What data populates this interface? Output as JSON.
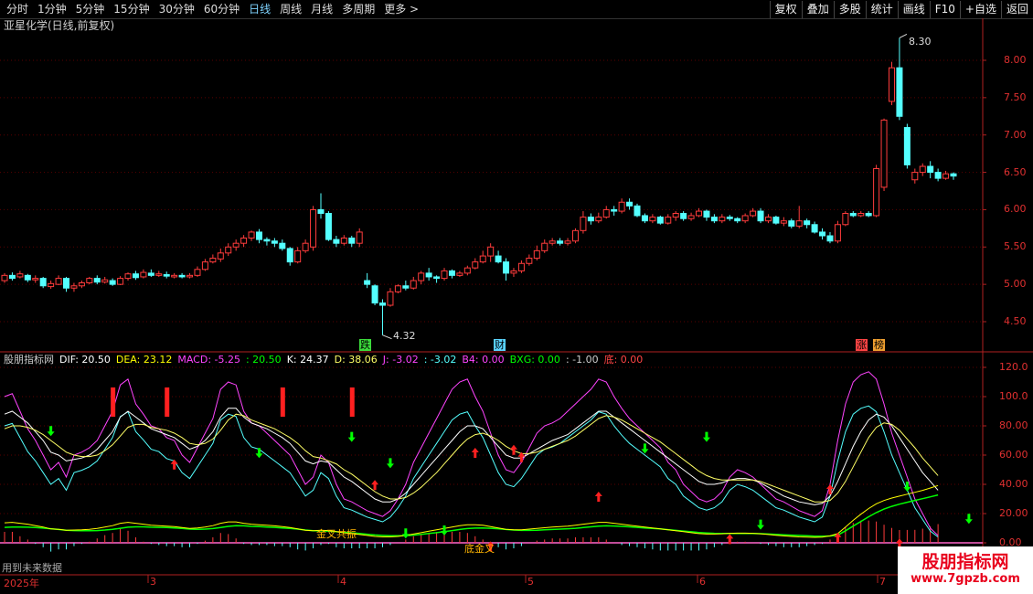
{
  "toolbar": {
    "periods": [
      "分时",
      "1分钟",
      "5分钟",
      "15分钟",
      "30分钟",
      "60分钟",
      "日线",
      "周线",
      "月线",
      "多周期",
      "更多 >"
    ],
    "actions": [
      "复权",
      "叠加",
      "多股",
      "统计",
      "画线",
      "F10",
      "+自选",
      "返回"
    ]
  },
  "stock": {
    "title": "亚星化学(日线,前复权)",
    "high_label": "8.30",
    "low_label": "4.32",
    "marker_die": "跌",
    "marker_cai": "财",
    "marker_zhang": "涨",
    "marker_bang": "榜",
    "y_ticks": [
      "8.00",
      "7.50",
      "7.00",
      "6.50",
      "6.00",
      "5.50",
      "5.00",
      "4.50"
    ]
  },
  "indicator": {
    "name": "股朋指标网",
    "dif": "DIF: 20.50",
    "dea": "DEA: 23.12",
    "macd": "MACD: -5.25",
    "v1": ": 20.50",
    "k": "K: 24.37",
    "d": "D: 38.06",
    "j": "J: -3.02",
    "v2": ": -3.02",
    "b4": "B4: 0.00",
    "bxg": "BXG: 0.00",
    "v3": ": -1.00",
    "di": "底: 0.00",
    "y_ticks": [
      "120.0",
      "100.0",
      "80.00",
      "60.00",
      "40.00",
      "20.00",
      "0.00"
    ],
    "annot_1": "金叉共振",
    "annot_2": "底金叉",
    "note": "用到未来数据"
  },
  "xaxis": {
    "labels": [
      "2025年",
      "3",
      "4",
      "5",
      "6",
      "7"
    ]
  },
  "watermark": {
    "line1": "股朋指标网",
    "line2": "www.7gpzb.com"
  },
  "colors": {
    "up": "#ff3c3c",
    "down": "#54ffff",
    "dif": "#ffffff",
    "dea": "#ffff00",
    "j": "#ff44ff",
    "k": "#ffffff",
    "d": "#ffff66",
    "bxg": "#00ff00"
  },
  "chart_data": {
    "type": "candlestick",
    "title": "亚星化学(日线,前复权)",
    "ylim": [
      4.2,
      8.5
    ],
    "candles": [
      [
        5.05,
        5.12,
        5.15,
        5.02
      ],
      [
        5.12,
        5.08,
        5.16,
        5.05
      ],
      [
        5.1,
        5.14,
        5.18,
        5.08
      ],
      [
        5.12,
        5.06,
        5.14,
        5.03
      ],
      [
        5.06,
        5.08,
        5.12,
        5.02
      ],
      [
        5.08,
        4.98,
        5.1,
        4.95
      ],
      [
        4.97,
        5.01,
        5.05,
        4.94
      ],
      [
        5.0,
        5.08,
        5.12,
        4.99
      ],
      [
        5.08,
        4.95,
        5.1,
        4.9
      ],
      [
        4.95,
        4.98,
        5.02,
        4.9
      ],
      [
        4.98,
        5.02,
        5.05,
        4.95
      ],
      [
        5.02,
        5.08,
        5.1,
        5.0
      ],
      [
        5.08,
        5.03,
        5.12,
        5.0
      ],
      [
        5.03,
        5.06,
        5.1,
        5.01
      ],
      [
        5.05,
        5.0,
        5.08,
        4.98
      ],
      [
        5.0,
        5.08,
        5.11,
        4.99
      ],
      [
        5.08,
        5.14,
        5.16,
        5.05
      ],
      [
        5.14,
        5.09,
        5.18,
        5.06
      ],
      [
        5.1,
        5.16,
        5.2,
        5.08
      ],
      [
        5.15,
        5.12,
        5.2,
        5.1
      ],
      [
        5.12,
        5.14,
        5.18,
        5.1
      ],
      [
        5.13,
        5.11,
        5.17,
        5.08
      ],
      [
        5.1,
        5.12,
        5.15,
        5.08
      ],
      [
        5.12,
        5.1,
        5.15,
        5.08
      ],
      [
        5.1,
        5.12,
        5.15,
        5.08
      ],
      [
        5.12,
        5.2,
        5.24,
        5.1
      ],
      [
        5.2,
        5.3,
        5.34,
        5.18
      ],
      [
        5.3,
        5.35,
        5.4,
        5.28
      ],
      [
        5.34,
        5.42,
        5.48,
        5.3
      ],
      [
        5.42,
        5.5,
        5.55,
        5.38
      ],
      [
        5.5,
        5.55,
        5.6,
        5.45
      ],
      [
        5.55,
        5.62,
        5.66,
        5.5
      ],
      [
        5.62,
        5.7,
        5.72,
        5.58
      ],
      [
        5.7,
        5.6,
        5.74,
        5.55
      ],
      [
        5.6,
        5.58,
        5.63,
        5.52
      ],
      [
        5.58,
        5.55,
        5.62,
        5.5
      ],
      [
        5.55,
        5.48,
        5.6,
        5.45
      ],
      [
        5.48,
        5.3,
        5.5,
        5.25
      ],
      [
        5.3,
        5.45,
        5.5,
        5.28
      ],
      [
        5.45,
        5.55,
        5.6,
        5.42
      ],
      [
        5.5,
        6.0,
        6.05,
        5.45
      ],
      [
        6.0,
        5.95,
        6.22,
        5.88
      ],
      [
        5.95,
        5.6,
        5.98,
        5.58
      ],
      [
        5.6,
        5.55,
        5.65,
        5.5
      ],
      [
        5.55,
        5.62,
        5.66,
        5.52
      ],
      [
        5.62,
        5.55,
        5.65,
        5.5
      ],
      [
        5.55,
        5.7,
        5.75,
        5.5
      ],
      [
        5.05,
        5.0,
        5.15,
        4.95
      ],
      [
        4.98,
        4.75,
        5.0,
        4.72
      ],
      [
        4.75,
        4.72,
        4.8,
        4.32
      ],
      [
        4.72,
        4.9,
        4.95,
        4.7
      ],
      [
        4.9,
        4.98,
        5.0,
        4.88
      ],
      [
        4.98,
        4.95,
        5.05,
        4.92
      ],
      [
        4.95,
        5.05,
        5.1,
        4.93
      ],
      [
        5.05,
        5.15,
        5.18,
        5.0
      ],
      [
        5.15,
        5.1,
        5.22,
        5.05
      ],
      [
        5.1,
        5.08,
        5.12,
        5.02
      ],
      [
        5.08,
        5.18,
        5.22,
        5.05
      ],
      [
        5.18,
        5.12,
        5.2,
        5.08
      ],
      [
        5.12,
        5.15,
        5.18,
        5.1
      ],
      [
        5.15,
        5.22,
        5.25,
        5.12
      ],
      [
        5.22,
        5.3,
        5.35,
        5.2
      ],
      [
        5.3,
        5.38,
        5.45,
        5.28
      ],
      [
        5.38,
        5.5,
        5.55,
        5.3
      ],
      [
        5.38,
        5.3,
        5.45,
        5.28
      ],
      [
        5.3,
        5.15,
        5.35,
        5.05
      ],
      [
        5.15,
        5.18,
        5.22,
        5.1
      ],
      [
        5.18,
        5.28,
        5.32,
        5.15
      ],
      [
        5.28,
        5.35,
        5.4,
        5.25
      ],
      [
        5.35,
        5.45,
        5.52,
        5.32
      ],
      [
        5.45,
        5.55,
        5.6,
        5.42
      ],
      [
        5.55,
        5.58,
        5.62,
        5.52
      ],
      [
        5.58,
        5.55,
        5.62,
        5.52
      ],
      [
        5.55,
        5.58,
        5.62,
        5.52
      ],
      [
        5.58,
        5.72,
        5.75,
        5.55
      ],
      [
        5.72,
        5.9,
        5.98,
        5.68
      ],
      [
        5.9,
        5.85,
        5.95,
        5.8
      ],
      [
        5.85,
        5.9,
        5.96,
        5.82
      ],
      [
        5.9,
        6.0,
        6.05,
        5.88
      ],
      [
        6.0,
        5.98,
        6.05,
        5.92
      ],
      [
        5.98,
        6.1,
        6.15,
        5.95
      ],
      [
        6.1,
        6.05,
        6.15,
        6.0
      ],
      [
        6.05,
        5.92,
        6.08,
        5.9
      ],
      [
        5.92,
        5.85,
        5.95,
        5.82
      ],
      [
        5.85,
        5.9,
        5.94,
        5.82
      ],
      [
        5.9,
        5.82,
        5.92,
        5.8
      ],
      [
        5.82,
        5.9,
        5.94,
        5.8
      ],
      [
        5.9,
        5.95,
        5.98,
        5.85
      ],
      [
        5.95,
        5.88,
        5.98,
        5.85
      ],
      [
        5.88,
        5.92,
        5.96,
        5.85
      ],
      [
        5.92,
        5.98,
        6.02,
        5.9
      ],
      [
        5.98,
        5.9,
        6.0,
        5.85
      ],
      [
        5.9,
        5.85,
        5.94,
        5.82
      ],
      [
        5.85,
        5.9,
        5.94,
        5.82
      ],
      [
        5.9,
        5.88,
        5.93,
        5.85
      ],
      [
        5.88,
        5.85,
        5.9,
        5.82
      ],
      [
        5.85,
        5.92,
        5.95,
        5.82
      ],
      [
        5.92,
        5.98,
        6.02,
        5.9
      ],
      [
        5.98,
        5.85,
        6.02,
        5.82
      ],
      [
        5.85,
        5.9,
        5.94,
        5.82
      ],
      [
        5.9,
        5.82,
        5.92,
        5.8
      ],
      [
        5.82,
        5.85,
        5.9,
        5.78
      ],
      [
        5.85,
        5.78,
        5.88,
        5.75
      ],
      [
        5.78,
        5.85,
        6.05,
        5.75
      ],
      [
        5.85,
        5.8,
        5.88,
        5.75
      ],
      [
        5.8,
        5.7,
        5.84,
        5.68
      ],
      [
        5.7,
        5.65,
        5.75,
        5.6
      ],
      [
        5.65,
        5.58,
        5.7,
        5.55
      ],
      [
        5.58,
        5.8,
        5.85,
        5.55
      ],
      [
        5.8,
        5.95,
        5.98,
        5.78
      ],
      [
        5.95,
        5.92,
        5.98,
        5.9
      ],
      [
        5.92,
        5.95,
        5.98,
        5.9
      ],
      [
        5.95,
        5.92,
        5.98,
        5.9
      ],
      [
        5.92,
        6.55,
        6.6,
        5.9
      ],
      [
        6.3,
        7.2,
        7.22,
        6.25
      ],
      [
        7.45,
        7.9,
        7.98,
        7.4
      ],
      [
        7.9,
        7.25,
        8.3,
        7.2
      ],
      [
        7.1,
        6.6,
        7.15,
        6.55
      ],
      [
        6.4,
        6.5,
        6.55,
        6.35
      ],
      [
        6.5,
        6.58,
        6.62,
        6.45
      ],
      [
        6.58,
        6.5,
        6.65,
        6.42
      ],
      [
        6.5,
        6.42,
        6.55,
        6.38
      ],
      [
        6.42,
        6.48,
        6.52,
        6.4
      ],
      [
        6.48,
        6.45,
        6.5,
        6.4
      ]
    ],
    "indicator": {
      "ylim": [
        0,
        125
      ],
      "j": [
        100,
        102,
        90,
        78,
        70,
        60,
        50,
        55,
        45,
        60,
        62,
        65,
        70,
        80,
        90,
        108,
        112,
        95,
        88,
        80,
        78,
        72,
        70,
        60,
        55,
        65,
        75,
        85,
        105,
        110,
        108,
        90,
        82,
        80,
        75,
        70,
        65,
        60,
        50,
        40,
        45,
        60,
        55,
        40,
        30,
        28,
        25,
        22,
        20,
        18,
        22,
        30,
        40,
        55,
        65,
        75,
        85,
        95,
        105,
        110,
        112,
        100,
        90,
        75,
        60,
        50,
        48,
        55,
        65,
        75,
        80,
        82,
        85,
        90,
        95,
        100,
        105,
        112,
        110,
        100,
        92,
        85,
        80,
        75,
        70,
        65,
        55,
        50,
        40,
        35,
        30,
        28,
        30,
        35,
        45,
        50,
        48,
        45,
        40,
        35,
        30,
        28,
        25,
        22,
        20,
        18,
        22,
        40,
        70,
        95,
        110,
        115,
        117,
        112,
        95,
        75,
        60,
        45,
        30,
        20,
        10,
        5
      ],
      "k": [
        88,
        90,
        86,
        82,
        76,
        70,
        62,
        60,
        56,
        57,
        58,
        60,
        64,
        70,
        76,
        86,
        90,
        86,
        82,
        78,
        76,
        74,
        72,
        68,
        64,
        66,
        70,
        76,
        86,
        92,
        92,
        86,
        82,
        80,
        78,
        75,
        72,
        68,
        62,
        56,
        54,
        56,
        55,
        50,
        45,
        42,
        38,
        34,
        30,
        28,
        28,
        30,
        34,
        40,
        46,
        52,
        58,
        64,
        70,
        76,
        80,
        80,
        78,
        72,
        66,
        60,
        58,
        58,
        61,
        64,
        67,
        70,
        72,
        74,
        78,
        82,
        86,
        90,
        90,
        86,
        82,
        78,
        74,
        70,
        66,
        62,
        58,
        54,
        50,
        46,
        42,
        40,
        40,
        41,
        43,
        44,
        44,
        43,
        41,
        38,
        35,
        32,
        30,
        28,
        27,
        26,
        27,
        32,
        42,
        54,
        66,
        76,
        84,
        88,
        86,
        80,
        72,
        64,
        56,
        48,
        42,
        36
      ],
      "d": [
        78,
        80,
        80,
        79,
        77,
        74,
        70,
        66,
        62,
        60,
        59,
        59,
        60,
        63,
        67,
        73,
        79,
        81,
        81,
        79,
        78,
        77,
        75,
        72,
        68,
        67,
        68,
        71,
        77,
        84,
        88,
        87,
        84,
        82,
        80,
        78,
        75,
        72,
        68,
        63,
        59,
        58,
        56,
        54,
        50,
        47,
        43,
        39,
        35,
        32,
        30,
        30,
        31,
        34,
        38,
        43,
        48,
        54,
        60,
        66,
        71,
        74,
        75,
        73,
        70,
        66,
        63,
        61,
        61,
        62,
        64,
        66,
        68,
        70,
        73,
        77,
        81,
        85,
        87,
        86,
        84,
        81,
        78,
        75,
        72,
        69,
        65,
        61,
        57,
        53,
        49,
        46,
        44,
        43,
        43,
        43,
        43,
        43,
        42,
        40,
        38,
        36,
        34,
        32,
        30,
        28,
        28,
        29,
        34,
        42,
        52,
        62,
        72,
        79,
        82,
        81,
        77,
        71,
        65,
        58,
        52,
        46
      ]
    }
  }
}
